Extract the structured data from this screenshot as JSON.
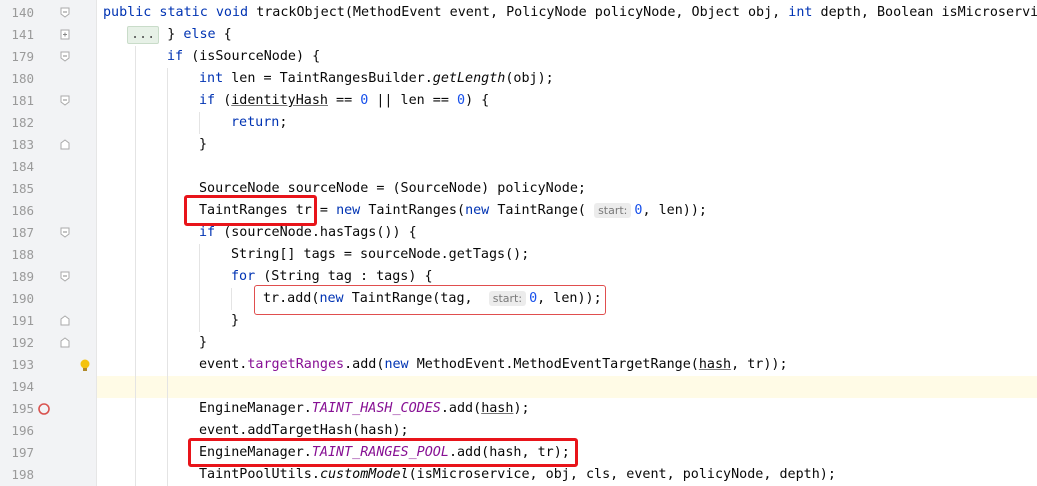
{
  "editor": {
    "lines": [
      {
        "no": "140"
      },
      {
        "no": "141"
      },
      {
        "no": "179"
      },
      {
        "no": "180"
      },
      {
        "no": "181"
      },
      {
        "no": "182"
      },
      {
        "no": "183"
      },
      {
        "no": "184"
      },
      {
        "no": "185"
      },
      {
        "no": "186"
      },
      {
        "no": "187"
      },
      {
        "no": "188"
      },
      {
        "no": "189"
      },
      {
        "no": "190"
      },
      {
        "no": "191"
      },
      {
        "no": "192"
      },
      {
        "no": "193"
      },
      {
        "no": "194"
      },
      {
        "no": "195"
      },
      {
        "no": "196"
      },
      {
        "no": "197"
      },
      {
        "no": "198"
      }
    ],
    "hints": {
      "start": "start:"
    },
    "fold_placeholder": "...",
    "markers": {
      "line193": "bulb-icon",
      "line195": "breakpoint-icon"
    }
  }
}
